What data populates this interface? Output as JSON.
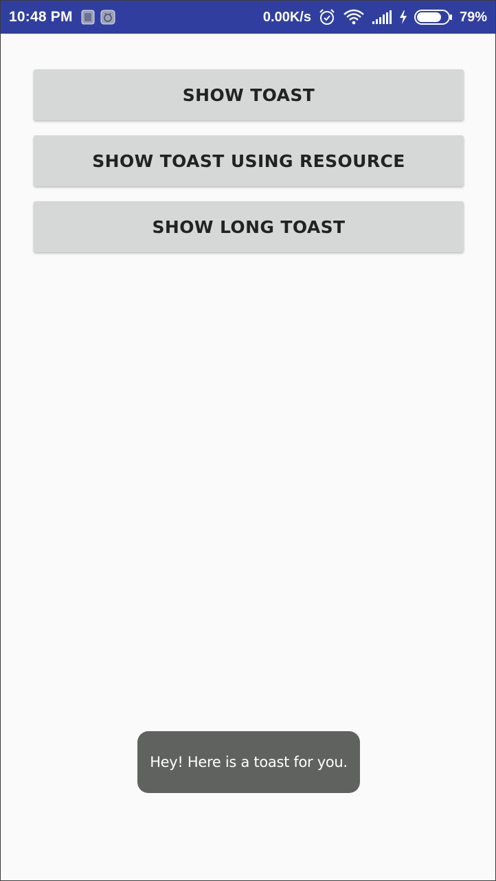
{
  "status_bar": {
    "time": "10:48 PM",
    "left_icons": [
      "sim-card-icon",
      "android-debug-icon"
    ],
    "net_speed": "0.00K/s",
    "right_icons": [
      "alarm-clock-icon",
      "wifi-icon",
      "signal-icon",
      "charging-icon",
      "battery-icon"
    ],
    "battery_percent": "79%",
    "battery_level": 0.79,
    "background_color": "#303f9f"
  },
  "main": {
    "buttons": [
      {
        "label": "SHOW TOAST"
      },
      {
        "label": "SHOW TOAST USING RESOURCE"
      },
      {
        "label": "SHOW LONG TOAST"
      }
    ]
  },
  "toast": {
    "message": "Hey! Here is a toast for you."
  }
}
